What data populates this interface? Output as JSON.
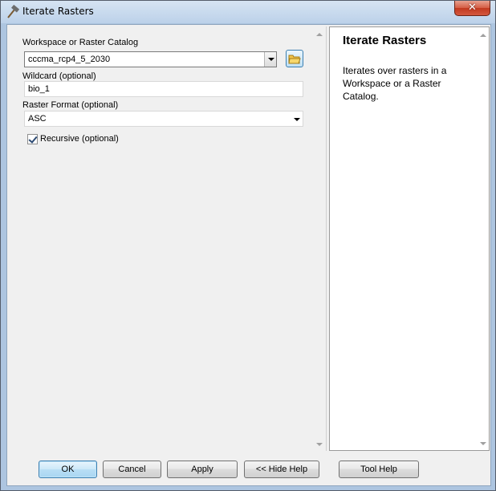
{
  "window": {
    "title": "Iterate Rasters",
    "close_glyph": "✕"
  },
  "params": {
    "workspace_label": "Workspace or Raster Catalog",
    "workspace_value": "cccma_rcp4_5_2030",
    "wildcard_label": "Wildcard (optional)",
    "wildcard_value": "bio_1",
    "format_label": "Raster Format (optional)",
    "format_value": "ASC",
    "recursive_label": "Recursive (optional)",
    "recursive_checked": true
  },
  "help": {
    "title": "Iterate Rasters",
    "text": "Iterates over rasters in a Workspace or a Raster Catalog."
  },
  "buttons": {
    "ok": "OK",
    "cancel": "Cancel",
    "apply": "Apply",
    "hide_help": "<< Hide Help",
    "tool_help": "Tool Help"
  },
  "colors": {
    "accent": "#3c7fb1",
    "close": "#c2391f"
  }
}
